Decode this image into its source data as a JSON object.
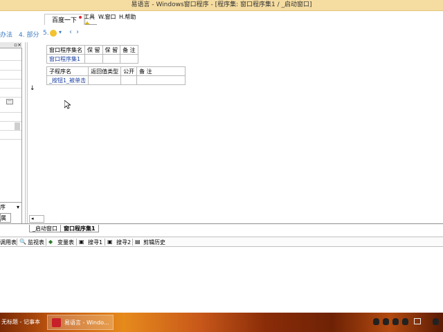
{
  "window": {
    "title": "易语言 - Windows窗口程序 - [程序集: 窗口程序集1 / _启动窗口]"
  },
  "menubar": {
    "items": [
      "工具",
      "W.窗口",
      "H.帮助"
    ]
  },
  "popup": {
    "label": "百度一下"
  },
  "toolbar2": {
    "text1": "办法",
    "text2": "4. 部分",
    "text3": "5."
  },
  "assembly_table": {
    "headers": [
      "窗口程序集名",
      "保 留",
      "保 留",
      "备 注"
    ],
    "rows": [
      [
        "窗口程序集1",
        "",
        "",
        ""
      ]
    ]
  },
  "sub_table": {
    "headers": [
      "子程序名",
      "返回值类型",
      "公开",
      "备 注"
    ],
    "rows": [
      [
        "_按钮1_被单击",
        "",
        "",
        ""
      ]
    ]
  },
  "left_panel": {
    "bottom_label": "序",
    "bottom_tab": "属性"
  },
  "editor_tabs": [
    "_启动窗口",
    "窗口程序集1"
  ],
  "bottom_tabs": [
    "调用表",
    "监视表",
    "变量表",
    "搜寻1",
    "搜寻2",
    "剪辑历史"
  ],
  "taskbar": {
    "item1": "无标题 - 记事本",
    "item2": "易语言 - Windo..."
  },
  "colors": {
    "taskbar_accent": "#c0560f",
    "link_blue": "#1a3fa0"
  }
}
